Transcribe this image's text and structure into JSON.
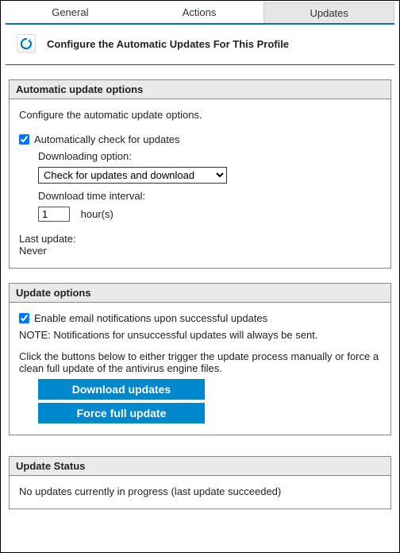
{
  "tabs": {
    "general": "General",
    "actions": "Actions",
    "updates": "Updates"
  },
  "header": {
    "title": "Configure the Automatic Updates For This Profile"
  },
  "auto": {
    "section_title": "Automatic update options",
    "desc": "Configure the automatic update options.",
    "auto_check_label": "Automatically check for updates",
    "auto_check_checked": true,
    "downloading_option_label": "Downloading option:",
    "downloading_option_selected": "Check for updates and download",
    "interval_label": "Download time interval:",
    "interval_value": "1",
    "interval_units": "hour(s)",
    "last_update_label": "Last update:",
    "last_update_value": "Never"
  },
  "upd": {
    "section_title": "Update options",
    "email_label": "Enable email notifications upon successful updates",
    "email_checked": true,
    "note": "NOTE: Notifications for unsuccessful updates will always be sent.",
    "instructions": "Click the buttons below to either trigger the update process manually or force a clean full update of the antivirus engine files.",
    "download_btn": "Download updates",
    "force_btn": "Force full update"
  },
  "status": {
    "section_title": "Update Status",
    "text": "No updates currently in progress (last update succeeded)"
  }
}
